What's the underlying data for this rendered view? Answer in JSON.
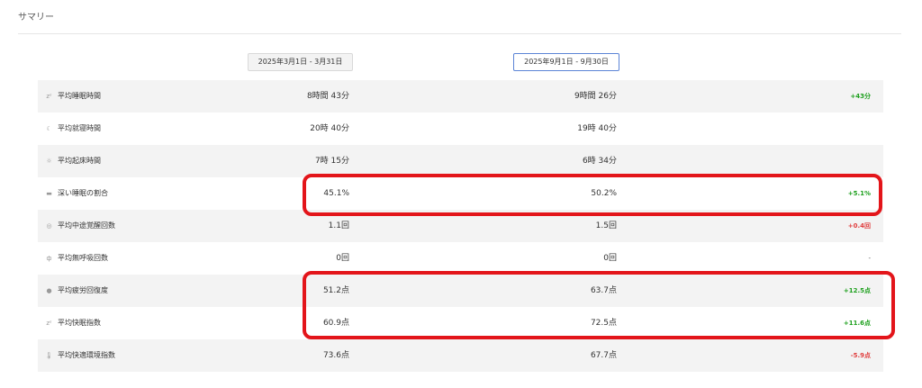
{
  "section_title": "サマリー",
  "periods": {
    "p1": "2025年3月1日 - 3月31日",
    "p2": "2025年9月1日 - 9月30日"
  },
  "rows": [
    {
      "icon": "zz-icon",
      "label": "平均睡眠時間",
      "v1": "8時間 43分",
      "v2": "9時間 26分",
      "diff": "+43分",
      "diff_type": "pos"
    },
    {
      "icon": "moon-icon",
      "label": "平均就寝時間",
      "v1": "20時 40分",
      "v2": "19時 40分",
      "diff": "",
      "diff_type": "neu"
    },
    {
      "icon": "sun-icon",
      "label": "平均起床時間",
      "v1": "7時 15分",
      "v2": "6時 34分",
      "diff": "",
      "diff_type": "neu"
    },
    {
      "icon": "bed-icon",
      "label": "深い睡眠の割合",
      "v1": "45.1%",
      "v2": "50.2%",
      "diff": "+5.1%",
      "diff_type": "pos"
    },
    {
      "icon": "wake-icon",
      "label": "平均中途覚醒回数",
      "v1": "1.1回",
      "v2": "1.5回",
      "diff": "+0.4回",
      "diff_type": "neg"
    },
    {
      "icon": "lungs-icon",
      "label": "平均無呼吸回数",
      "v1": "0回",
      "v2": "0回",
      "diff": "-",
      "diff_type": "neu"
    },
    {
      "icon": "person-icon",
      "label": "平均疲労回復度",
      "v1": "51.2点",
      "v2": "63.7点",
      "diff": "+12.5点",
      "diff_type": "pos"
    },
    {
      "icon": "zz-icon",
      "label": "平均快眠指数",
      "v1": "60.9点",
      "v2": "72.5点",
      "diff": "+11.6点",
      "diff_type": "pos"
    },
    {
      "icon": "thermometer-icon",
      "label": "平均快適環境指数",
      "v1": "73.6点",
      "v2": "67.7点",
      "diff": "-5.9点",
      "diff_type": "neg"
    }
  ],
  "colors": {
    "highlight": "#e3151a",
    "positive": "#1ea01e",
    "negative": "#e04040",
    "selected_border": "#5b84d6"
  }
}
